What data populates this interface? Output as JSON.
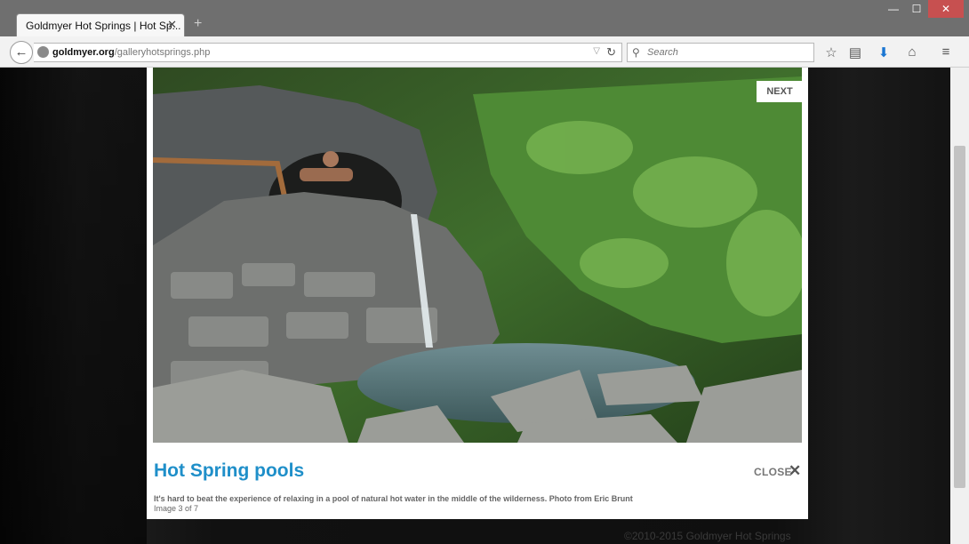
{
  "browser": {
    "tab_title": "Goldmyer Hot Springs | Hot Sp...",
    "url_host": "goldmyer.org",
    "url_path": "/galleryhotsprings.php",
    "search_placeholder": "Search"
  },
  "gallery": {
    "next_label": "NEXT",
    "title": "Hot Spring pools",
    "close_label": "CLOSE",
    "description": "It's hard to beat the experience of relaxing in a pool of natural hot water in the middle of the wilderness. Photo from Eric Brunt",
    "counter": "Image 3 of 7"
  },
  "footer": {
    "copyright": "©2010-2015 Goldmyer Hot Springs"
  },
  "colors": {
    "title_accent": "#1f8fc9",
    "close_button": "#c75050",
    "download_icon": "#1a76d2"
  }
}
